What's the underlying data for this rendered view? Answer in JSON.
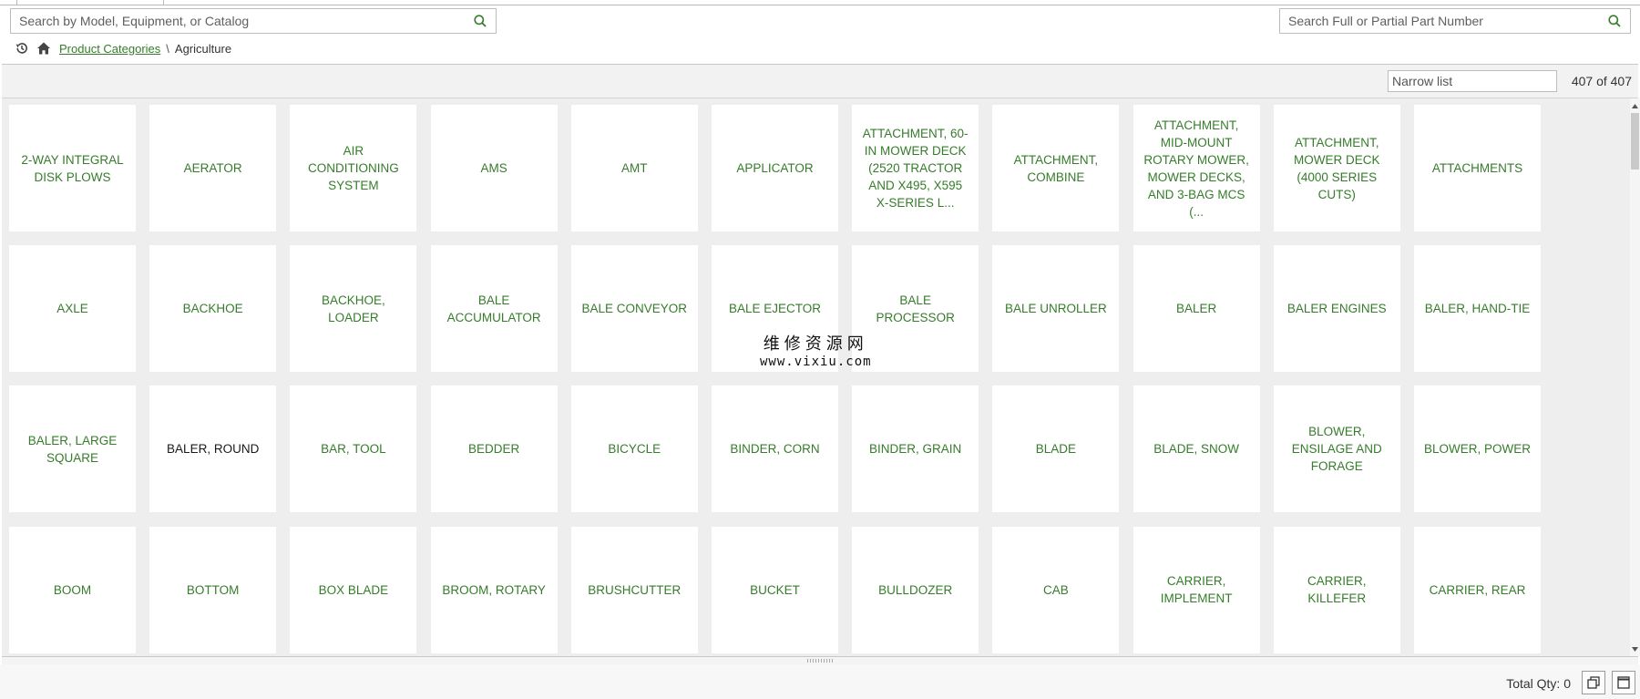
{
  "search_left": {
    "placeholder": "Search by Model, Equipment, or Catalog",
    "icon": "search-icon"
  },
  "search_right": {
    "placeholder": "Search Full or Partial Part Number",
    "icon": "search-icon"
  },
  "breadcrumb": {
    "link": "Product Categories",
    "separator": "\\",
    "current": "Agriculture"
  },
  "toolbar": {
    "narrow_placeholder": "Narrow list",
    "count": "407 of 407"
  },
  "tiles": [
    "2-WAY INTEGRAL DISK PLOWS",
    "AERATOR",
    "AIR CONDITIONING SYSTEM",
    "AMS",
    "AMT",
    "APPLICATOR",
    "ATTACHMENT, 60-IN MOWER DECK (2520 TRACTOR AND X495, X595 X-SERIES L...",
    "ATTACHMENT, COMBINE",
    "ATTACHMENT, MID-MOUNT ROTARY MOWER, MOWER DECKS, AND 3-BAG MCS (...",
    "ATTACHMENT, MOWER DECK (4000 SERIES CUTS)",
    "ATTACHMENTS",
    "AXLE",
    "BACKHOE",
    "BACKHOE, LOADER",
    "BALE ACCUMULATOR",
    "BALE CONVEYOR",
    "BALE EJECTOR",
    "BALE PROCESSOR",
    "BALE UNROLLER",
    "BALER",
    "BALER ENGINES",
    "BALER, HAND-TIE",
    "BALER, LARGE SQUARE",
    "BALER, ROUND",
    "BAR, TOOL",
    "BEDDER",
    "BICYCLE",
    "BINDER, CORN",
    "BINDER, GRAIN",
    "BLADE",
    "BLADE, SNOW",
    "BLOWER, ENSILAGE AND FORAGE",
    "BLOWER, POWER",
    "BOOM",
    "BOTTOM",
    "BOX BLADE",
    "BROOM, ROTARY",
    "BRUSHCUTTER",
    "BUCKET",
    "BULLDOZER",
    "CAB",
    "CARRIER, IMPLEMENT",
    "CARRIER, KILLEFER",
    "CARRIER, REAR"
  ],
  "hovered_tile": "BALER, ROUND",
  "watermark": {
    "line1": "维修资源网",
    "line2": "www.vixiu.com"
  },
  "footer": {
    "total_qty": "Total Qty: 0"
  },
  "colors": {
    "accent": "#367c2b",
    "tile_bg": "#ffffff",
    "grid_bg": "#eeeeee"
  }
}
